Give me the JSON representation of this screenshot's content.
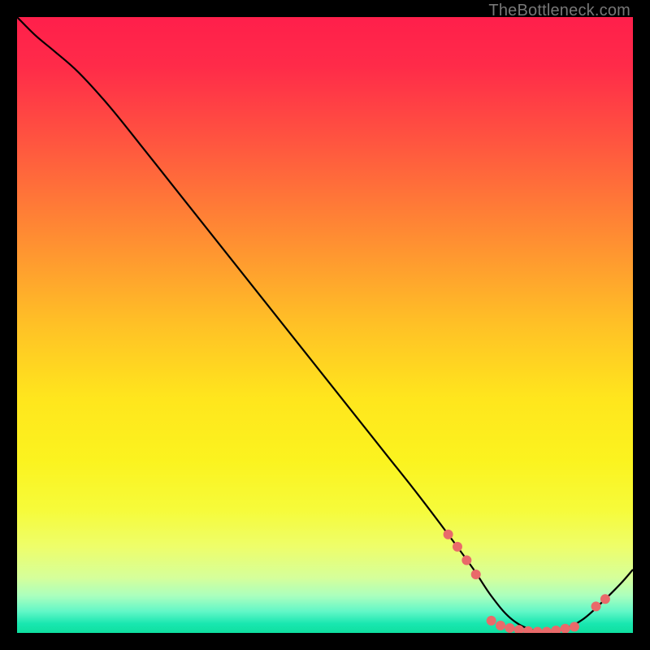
{
  "watermark": "TheBottleneck.com",
  "chart_data": {
    "type": "line",
    "title": "",
    "xlabel": "",
    "ylabel": "",
    "xlim": [
      0,
      100
    ],
    "ylim": [
      0,
      100
    ],
    "grid": false,
    "legend": false,
    "annotations": [],
    "background": {
      "type": "vertical-gradient",
      "stops": [
        {
          "offset": 0.0,
          "color": "#ff1f4b"
        },
        {
          "offset": 0.08,
          "color": "#ff2b49"
        },
        {
          "offset": 0.2,
          "color": "#ff5440"
        },
        {
          "offset": 0.35,
          "color": "#ff8a33"
        },
        {
          "offset": 0.5,
          "color": "#ffc126"
        },
        {
          "offset": 0.62,
          "color": "#ffe61d"
        },
        {
          "offset": 0.72,
          "color": "#fbf31f"
        },
        {
          "offset": 0.8,
          "color": "#f6fb3a"
        },
        {
          "offset": 0.86,
          "color": "#eefe6a"
        },
        {
          "offset": 0.91,
          "color": "#d6ff9a"
        },
        {
          "offset": 0.94,
          "color": "#aaffbe"
        },
        {
          "offset": 0.965,
          "color": "#62f7c7"
        },
        {
          "offset": 0.985,
          "color": "#19e7b0"
        },
        {
          "offset": 1.0,
          "color": "#0fdf9f"
        }
      ]
    },
    "series": [
      {
        "name": "curve",
        "color": "#000000",
        "x": [
          0.0,
          3.0,
          6.0,
          10.0,
          15.0,
          20.0,
          25.0,
          30.0,
          35.0,
          40.0,
          45.0,
          50.0,
          55.0,
          60.0,
          65.0,
          70.0,
          74.0,
          77.0,
          80.0,
          83.0,
          86.0,
          89.0,
          92.0,
          95.0,
          98.0,
          100.0
        ],
        "y": [
          100.0,
          97.0,
          94.5,
          91.0,
          85.5,
          79.3,
          73.0,
          66.7,
          60.4,
          54.1,
          47.8,
          41.5,
          35.2,
          28.9,
          22.6,
          16.0,
          10.5,
          6.0,
          2.5,
          0.7,
          0.2,
          0.7,
          2.3,
          5.0,
          8.0,
          10.3
        ]
      }
    ],
    "markers": [
      {
        "series": "curve",
        "x": 70.0,
        "y": 16.0,
        "color": "#e96a6a"
      },
      {
        "series": "curve",
        "x": 71.5,
        "y": 14.0,
        "color": "#e96a6a"
      },
      {
        "series": "curve",
        "x": 73.0,
        "y": 11.8,
        "color": "#e96a6a"
      },
      {
        "series": "curve",
        "x": 74.5,
        "y": 9.5,
        "color": "#e96a6a"
      },
      {
        "series": "curve",
        "x": 77.0,
        "y": 2.0,
        "color": "#e96a6a"
      },
      {
        "series": "curve",
        "x": 78.5,
        "y": 1.2,
        "color": "#e96a6a"
      },
      {
        "series": "curve",
        "x": 80.0,
        "y": 0.8,
        "color": "#e96a6a"
      },
      {
        "series": "curve",
        "x": 81.5,
        "y": 0.5,
        "color": "#e96a6a"
      },
      {
        "series": "curve",
        "x": 83.0,
        "y": 0.3,
        "color": "#e96a6a"
      },
      {
        "series": "curve",
        "x": 84.5,
        "y": 0.2,
        "color": "#e96a6a"
      },
      {
        "series": "curve",
        "x": 86.0,
        "y": 0.2,
        "color": "#e96a6a"
      },
      {
        "series": "curve",
        "x": 87.5,
        "y": 0.4,
        "color": "#e96a6a"
      },
      {
        "series": "curve",
        "x": 89.0,
        "y": 0.7,
        "color": "#e96a6a"
      },
      {
        "series": "curve",
        "x": 90.5,
        "y": 1.0,
        "color": "#e96a6a"
      },
      {
        "series": "curve",
        "x": 94.0,
        "y": 4.3,
        "color": "#e96a6a"
      },
      {
        "series": "curve",
        "x": 95.5,
        "y": 5.5,
        "color": "#e96a6a"
      }
    ]
  }
}
